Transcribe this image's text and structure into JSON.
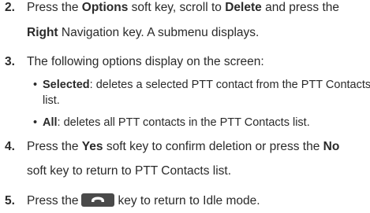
{
  "steps": [
    {
      "num": "2.",
      "l1_a": "Press the ",
      "l1_b": "Options",
      "l1_c": " soft key, scroll to ",
      "l1_d": "Delete",
      "l1_e": " and press the",
      "l2_a": "Right",
      "l2_b": " Navigation key. A submenu displays."
    },
    {
      "num": "3.",
      "l1": "The following options display on the screen:"
    },
    {
      "num": "4.",
      "l1_a": "Press the ",
      "l1_b": "Yes",
      "l1_c": " soft key to confirm deletion or press the ",
      "l1_d": "No",
      "l2": "soft key to return to PTT Contacts list."
    },
    {
      "num": "5.",
      "l1_a": "Press the",
      "l1_b": "key to return to Idle mode.",
      "icon": "end-key-icon"
    }
  ],
  "bullets": [
    {
      "term": "Selected",
      "desc": ": deletes a selected PTT contact from the PTT Contacts",
      "cont": "list."
    },
    {
      "term": "All",
      "desc": ": deletes all PTT contacts in the PTT Contacts list."
    }
  ]
}
